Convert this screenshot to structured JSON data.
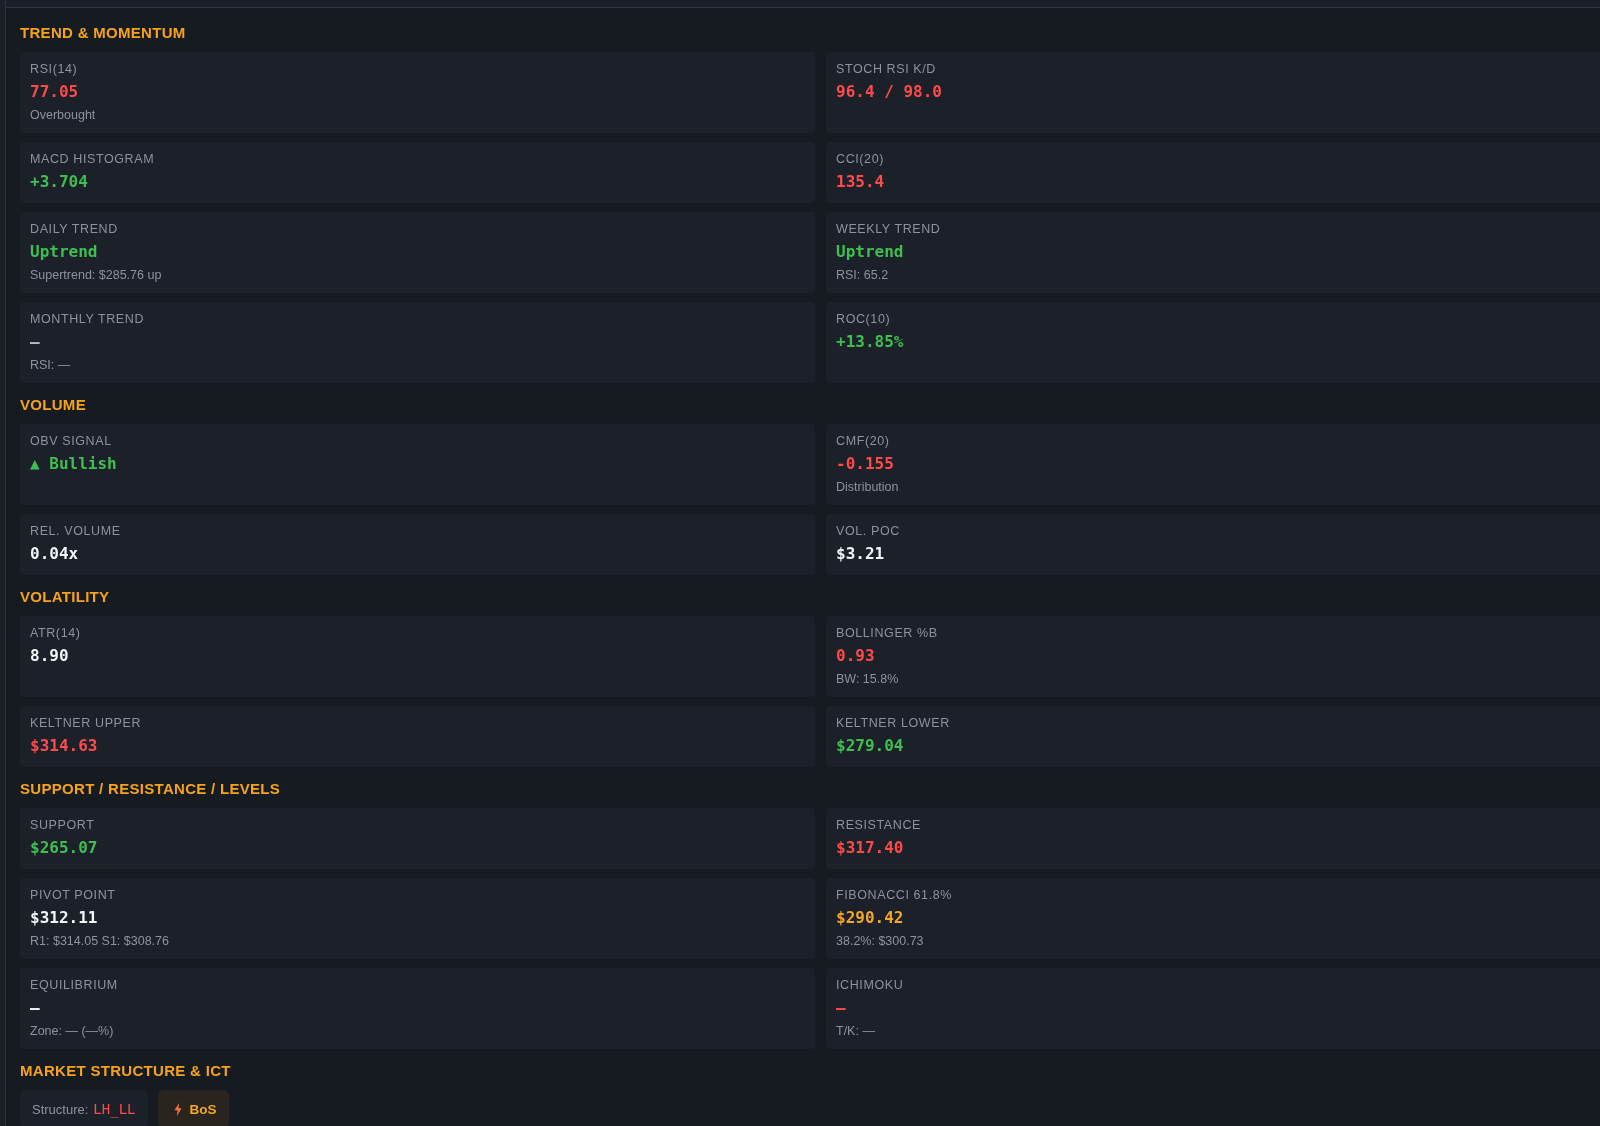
{
  "sections": [
    {
      "title": "TREND & MOMENTUM",
      "cards": [
        {
          "label": "RSI(14)",
          "value": "77.05",
          "color": "#ff4a4a",
          "note": "Overbought"
        },
        {
          "label": "STOCH RSI K/D",
          "value": "96.4 / 98.0",
          "color": "#ff4a4a"
        },
        {
          "label": "MACD HISTOGRAM",
          "value": "+3.704",
          "color": "#3fbf4f"
        },
        {
          "label": "CCI(20)",
          "value": "135.4",
          "color": "#ff4a4a"
        },
        {
          "label": "DAILY TREND",
          "value": "Uptrend",
          "color": "#3fbf4f",
          "note": "Supertrend: $285.76 up"
        },
        {
          "label": "WEEKLY TREND",
          "value": "Uptrend",
          "color": "#3fbf4f",
          "note": "RSI: 65.2"
        },
        {
          "label": "MONTHLY TREND",
          "value": "—",
          "color": "#b4bac3",
          "note": "RSI: —"
        },
        {
          "label": "ROC(10)",
          "value": "+13.85%",
          "color": "#3fbf4f"
        }
      ]
    },
    {
      "title": "VOLUME",
      "cards": [
        {
          "label": "OBV SIGNAL",
          "value": "▲ Bullish",
          "color": "#3fbf4f"
        },
        {
          "label": "CMF(20)",
          "value": "-0.155",
          "color": "#ff4a4a",
          "note": "Distribution"
        },
        {
          "label": "REL. VOLUME",
          "value": "0.04x",
          "color": "#f2f4f7"
        },
        {
          "label": "VOL. POC",
          "value": "$3.21",
          "color": "#f2f4f7"
        }
      ]
    },
    {
      "title": "VOLATILITY",
      "cards": [
        {
          "label": "ATR(14)",
          "value": "8.90",
          "color": "#f2f4f7"
        },
        {
          "label": "BOLLINGER %B",
          "value": "0.93",
          "color": "#ff4a4a",
          "note": "BW: 15.8%"
        },
        {
          "label": "KELTNER UPPER",
          "value": "$314.63",
          "color": "#ff4a4a"
        },
        {
          "label": "KELTNER LOWER",
          "value": "$279.04",
          "color": "#3fbf4f"
        }
      ]
    },
    {
      "title": "SUPPORT / RESISTANCE / LEVELS",
      "cards": [
        {
          "label": "SUPPORT",
          "value": "$265.07",
          "color": "#3fbf4f"
        },
        {
          "label": "RESISTANCE",
          "value": "$317.40",
          "color": "#ff4a4a"
        },
        {
          "label": "PIVOT POINT",
          "value": "$312.11",
          "color": "#f2f4f7",
          "note": "R1: $314.05 S1: $308.76"
        },
        {
          "label": "FIBONACCI 61.8%",
          "value": "$290.42",
          "color": "#f5a623",
          "note": "38.2%: $300.73"
        },
        {
          "label": "EQUILIBRIUM",
          "value": "—",
          "color": "#f2f4f7",
          "note": "Zone: — (—%)"
        },
        {
          "label": "ICHIMOKU",
          "value": "—",
          "color": "#ff4a4a",
          "note": "T/K: —"
        }
      ]
    },
    {
      "title": "MARKET STRUCTURE & ICT",
      "tags": [
        {
          "kind": "structure",
          "label": "Structure:",
          "value": "LH_LL",
          "color": "#ff4a4a"
        },
        {
          "kind": "signal",
          "value": "BoS",
          "color": "#f5a623"
        }
      ]
    }
  ]
}
